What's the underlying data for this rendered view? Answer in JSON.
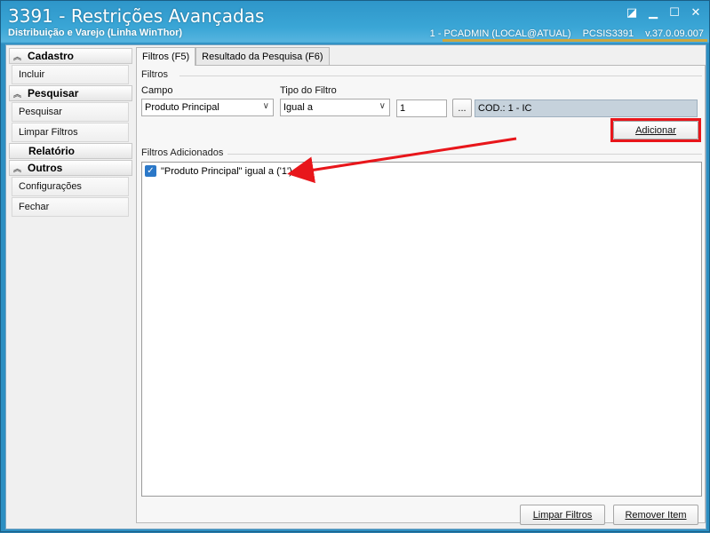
{
  "window": {
    "title": "3391 - Restrições Avançadas",
    "subtitle": "Distribuição e Varejo (Linha WinThor)",
    "user_info": "1 - PCADMIN (LOCAL@ATUAL)",
    "program": "PCSIS3391",
    "version": "v.37.0.09.007",
    "accent_color": "#c9a640"
  },
  "sidebar": {
    "groups": [
      {
        "label": "Cadastro",
        "items": [
          "Incluir"
        ]
      },
      {
        "label": "Pesquisar",
        "items": [
          "Pesquisar",
          "Limpar Filtros"
        ]
      },
      {
        "label": "Relatório",
        "items": []
      },
      {
        "label": "Outros",
        "items": [
          "Configurações",
          "Fechar"
        ]
      }
    ]
  },
  "tabs": {
    "filtros": "Filtros (F5)",
    "resultado": "Resultado da Pesquisa (F6)"
  },
  "filtros": {
    "section_label": "Filtros",
    "campo_label": "Campo",
    "campo_value": "Produto Principal",
    "tipo_label": "Tipo do Filtro",
    "tipo_value": "Igual a",
    "valor_value": "1",
    "browse_label": "...",
    "descricao_value": "COD.: 1 - IC",
    "adicionar_label": "Adicionar",
    "highlight_color": "#e8161b"
  },
  "filtros_adicionados": {
    "section_label": "Filtros Adicionados",
    "items": [
      {
        "text": "\"Produto Principal\" igual a ('1')",
        "checked": true
      }
    ]
  },
  "footer": {
    "limpar_label": "Limpar Filtros",
    "remover_label": "Remover Item"
  }
}
